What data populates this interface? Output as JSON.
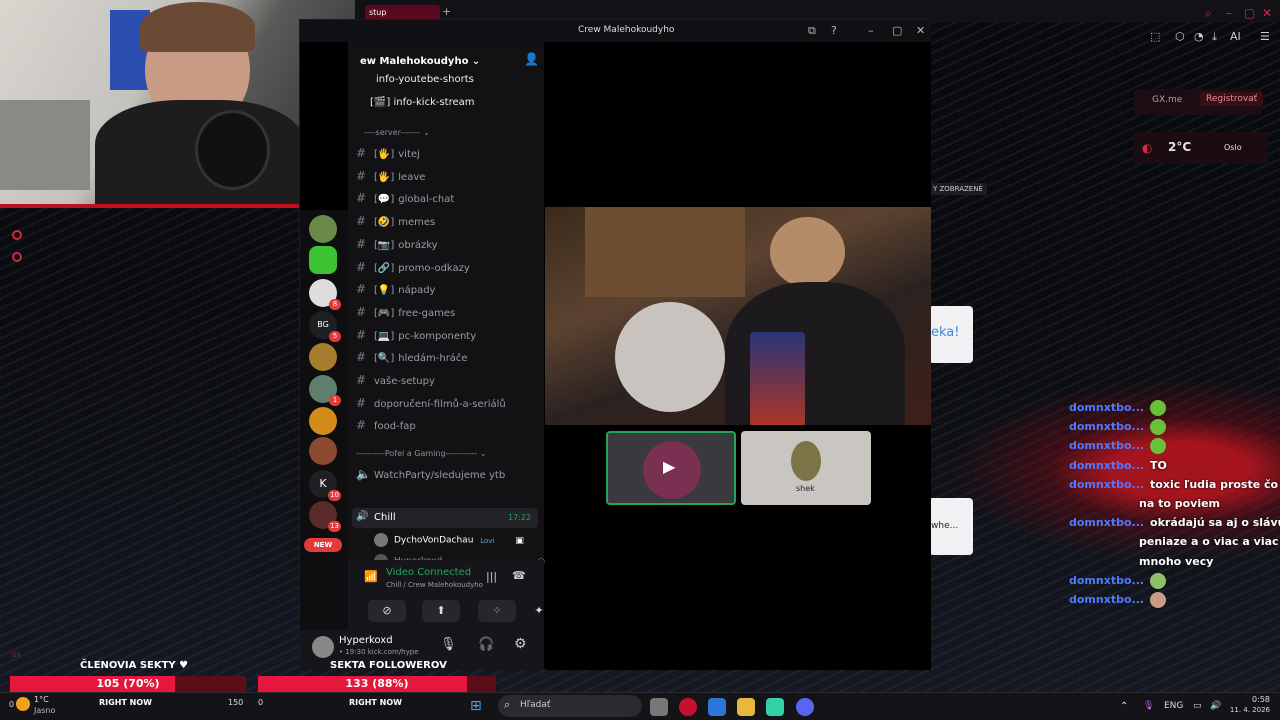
{
  "browser": {
    "tab_label": "stup",
    "gx_link": "GX.me",
    "register": "Registrovať",
    "weather_temp": "2°C",
    "weather_city": "Oslo",
    "ai_label": "AI",
    "zobrazene": "Y ZOBRAZENÉ",
    "ad_text": "eka!",
    "ad_text2": "whe..."
  },
  "discord": {
    "window_title": "Crew Malehokoudyho",
    "server_name": "ew Malehokoudyho",
    "channels_top": [
      {
        "label": "info-youtebe-shorts",
        "emoji": ""
      },
      {
        "label": "info-kick-stream",
        "emoji": "[🎬]"
      }
    ],
    "category_server": "----server------- ⌄",
    "channels": [
      {
        "label": "vitej",
        "emoji": "[🖐]"
      },
      {
        "label": "leave",
        "emoji": "[🖐]"
      },
      {
        "label": "global-chat",
        "emoji": "[💬]"
      },
      {
        "label": "memes",
        "emoji": "[🤣]"
      },
      {
        "label": "obrázky",
        "emoji": "[📷]"
      },
      {
        "label": "promo-odkazy",
        "emoji": "[🔗]"
      },
      {
        "label": "nápady",
        "emoji": "[💡]"
      },
      {
        "label": "free-games",
        "emoji": "[🎮]"
      },
      {
        "label": "pc-komponenty",
        "emoji": "[💻]"
      },
      {
        "label": "hledám-hráče",
        "emoji": "[🔍]"
      },
      {
        "label": "vaše-setupy",
        "emoji": ""
      },
      {
        "label": "doporučení-filmů-a-seriálů",
        "emoji": ""
      },
      {
        "label": "food-fap",
        "emoji": ""
      }
    ],
    "category_gaming": "----------Pofel a Gaming----------- ⌄",
    "voice_watchparty": "WatchParty/sledujeme ytb",
    "voice_chill": "Chill",
    "voice_chill_time": "17:22",
    "voice_users": [
      {
        "name": "DychoVonDachau",
        "tag": "Lovi"
      },
      {
        "name": "Hyperkoxd",
        "tag": ""
      }
    ],
    "server_badges": [
      "8",
      "5",
      "1",
      "10",
      "13"
    ],
    "server_new": "NEW",
    "voice_status": "Video Connected",
    "voice_location": "Chill / Crew Malehokoudyho",
    "me_name": "Hyperkoxd",
    "me_status": "• 19:30 kick.com/hype",
    "tile_label": "shek"
  },
  "chat": [
    {
      "name": "domnxtbo...",
      "text": "",
      "emote": "pepe"
    },
    {
      "name": "domnxtbo...",
      "text": "",
      "emote": "pepe"
    },
    {
      "name": "domnxtbo...",
      "text": "",
      "emote": "pepe"
    },
    {
      "name": "domnxtbo...",
      "text": "TO",
      "emote": ""
    },
    {
      "name": "domnxtbo...",
      "text": "toxic ľudia proste čo ti",
      "emote": ""
    },
    {
      "name": "",
      "text": "na to poviem",
      "emote": ""
    },
    {
      "name": "domnxtbo...",
      "text": "okrádajú sa aj o slávu o",
      "emote": ""
    },
    {
      "name": "",
      "text": "peniaze a o viac a viac",
      "emote": ""
    },
    {
      "name": "",
      "text": "mnoho vecy",
      "emote": ""
    },
    {
      "name": "domnxtbo...",
      "text": "",
      "emote": "face"
    },
    {
      "name": "domnxtbo...",
      "text": "",
      "emote": "face2"
    }
  ],
  "goals": {
    "title": "ČLENOVIA SEKTY ♥",
    "bar1": {
      "label": "105 (70%)",
      "percent": 70,
      "left": "0",
      "right": "150",
      "caption": "RIGHT NOW"
    },
    "title2": "SEKTA FOLLOWEROV",
    "bar2": {
      "label": "133 (88%)",
      "percent": 88,
      "left": "0",
      "caption": "RIGHT NOW"
    }
  },
  "taskbar": {
    "weather_temp": "1°C",
    "weather_desc": "Jasno",
    "search_placeholder": "Hľadať",
    "lang": "ENG",
    "time": "0:58",
    "date": "11. 4. 2026",
    "gx_corner": "GX"
  },
  "colors": {
    "accent": "#e5173c",
    "discord_green": "#23a55a",
    "chat_name": "#4f79ff"
  }
}
